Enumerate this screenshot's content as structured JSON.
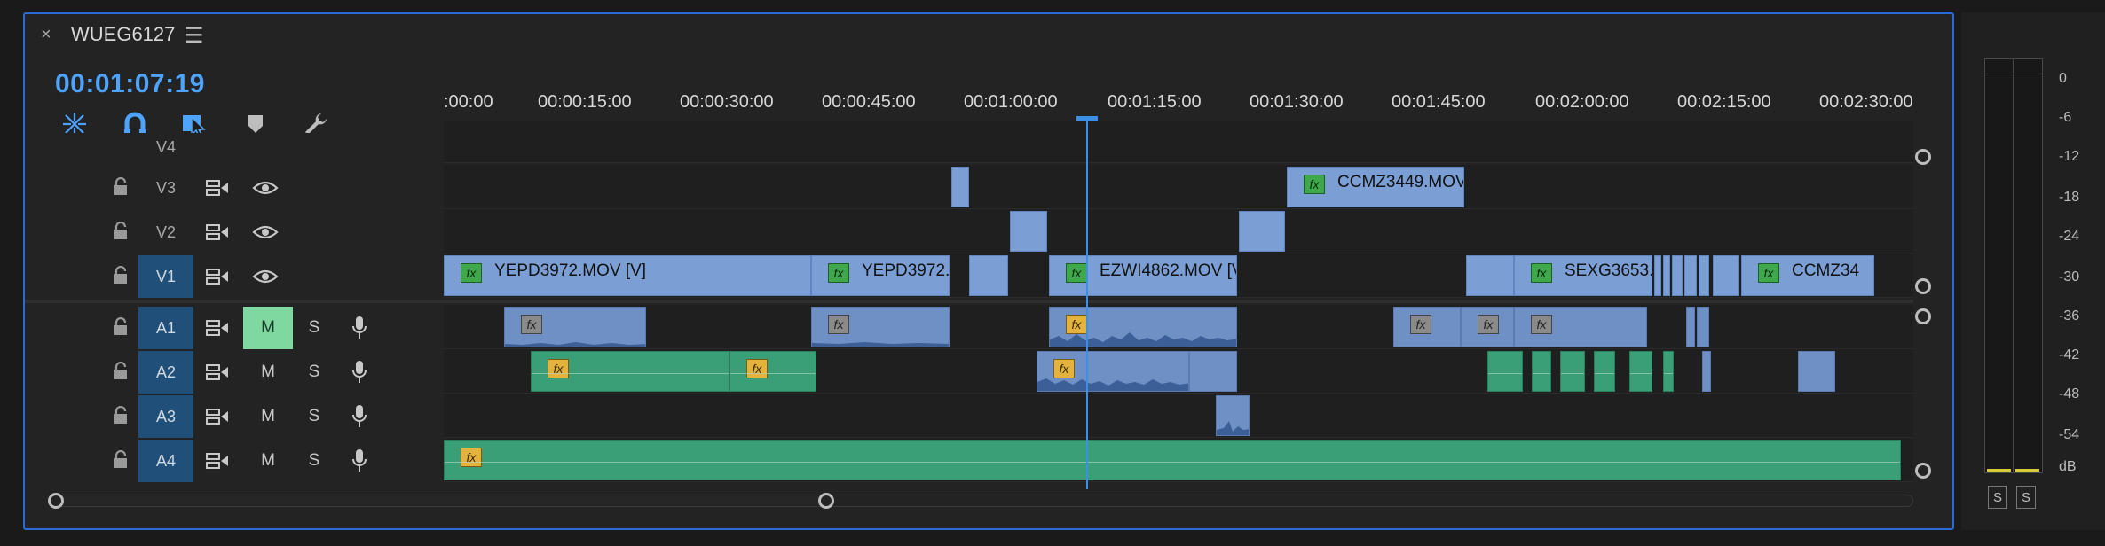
{
  "sequence": {
    "title": "WUEG6127",
    "close_label": "×",
    "menu_label": "☰",
    "timecode": "00:01:07:19"
  },
  "ruler": {
    "labels": [
      ":00:00",
      "00:00:15:00",
      "00:00:30:00",
      "00:00:45:00",
      "00:01:00:00",
      "00:01:15:00",
      "00:01:30:00",
      "00:01:45:00",
      "00:02:00:00",
      "00:02:15:00",
      "00:02:30:00"
    ]
  },
  "tracks": {
    "v4": {
      "label": "V4"
    },
    "v3": {
      "label": "V3"
    },
    "v2": {
      "label": "V2"
    },
    "v1": {
      "label": "V1"
    },
    "a1": {
      "label": "A1",
      "mute": "M",
      "solo": "S"
    },
    "a2": {
      "label": "A2",
      "mute": "M",
      "solo": "S"
    },
    "a3": {
      "label": "A3",
      "mute": "M",
      "solo": "S"
    },
    "a4": {
      "label": "A4",
      "mute": "M",
      "solo": "S"
    }
  },
  "clips": {
    "ccmz3449": "CCMZ3449.MOV",
    "yepd3972": "YEPD3972.MOV [V]",
    "yepd3972b": "YEPD3972.",
    "ezwi4862": "EZWI4862.MOV [V",
    "sexg3653": "SEXG3653.",
    "ccmz34": "CCMZ34",
    "fx": "fx"
  },
  "meter": {
    "ticks": [
      "0",
      "-6",
      "-12",
      "-18",
      "-24",
      "-30",
      "-36",
      "-42",
      "-48",
      "-54",
      "dB"
    ],
    "solo_left": "S",
    "solo_right": "S"
  },
  "colors": {
    "accent": "#4ea3ff",
    "video_clip": "#7b9fd4",
    "audio_clip": "#3a9f76",
    "mute_on": "#7fd8a0"
  }
}
